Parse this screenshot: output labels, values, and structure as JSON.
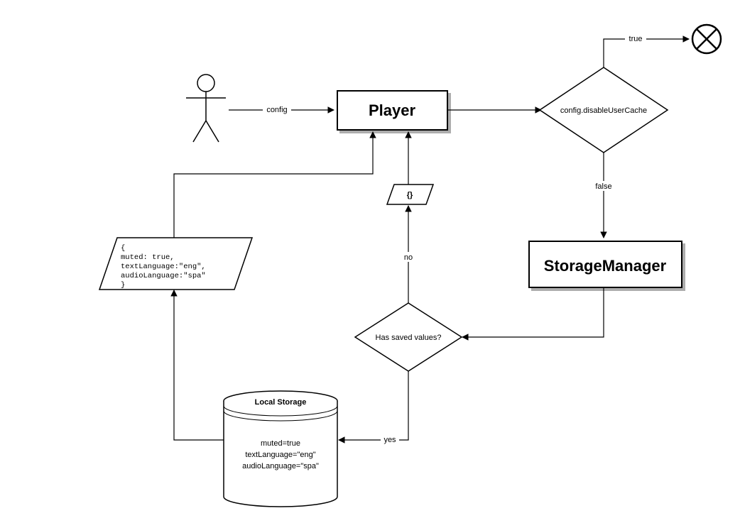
{
  "actor": {
    "label": ""
  },
  "edges": {
    "actor_to_player": "config",
    "decision1_true": "true",
    "decision1_false": "false",
    "decision2_yes": "yes",
    "decision2_no": "no"
  },
  "nodes": {
    "player": "Player",
    "decision1": "config.disableUserCache",
    "storage_manager": "StorageManager",
    "decision2": "Has saved values?",
    "empty_data": "{}",
    "saved_data_lines": [
      "{",
      " muted: true,",
      " textLanguage:\"eng\",",
      " audioLanguage:\"spa\"",
      "}"
    ],
    "local_storage_title": "Local Storage",
    "local_storage_lines": [
      "muted=true",
      "textLanguage=\"eng\"",
      "audioLanguage=\"spa\""
    ]
  }
}
